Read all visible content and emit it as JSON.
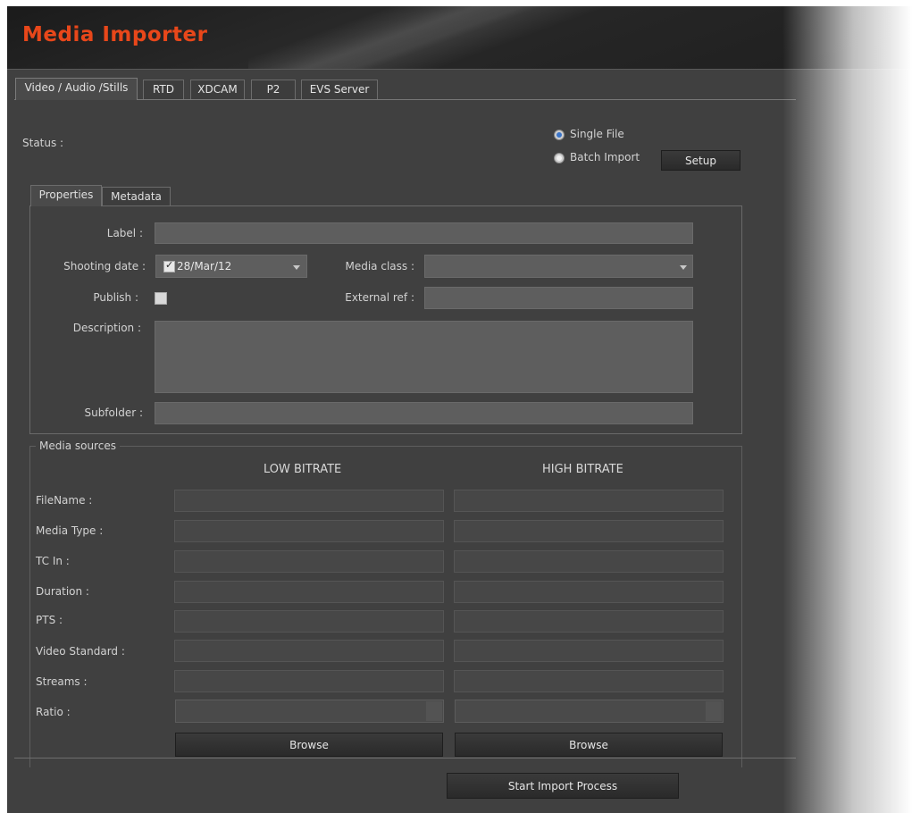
{
  "app": {
    "title": "Media Importer"
  },
  "main_tabs": [
    {
      "label": "Video / Audio /Stills",
      "active": true
    },
    {
      "label": "RTD",
      "active": false
    },
    {
      "label": "XDCAM",
      "active": false
    },
    {
      "label": "P2",
      "active": false
    },
    {
      "label": "EVS Server",
      "active": false
    }
  ],
  "status": {
    "label": "Status :"
  },
  "mode": {
    "single_file": "Single File",
    "batch_import": "Batch Import",
    "selected": "single_file",
    "setup_button": "Setup"
  },
  "sub_tabs": [
    {
      "label": "Properties",
      "active": true
    },
    {
      "label": "Metadata",
      "active": false
    }
  ],
  "properties": {
    "label_label": "Label :",
    "label_value": "",
    "shooting_date_label": "Shooting date :",
    "shooting_date_value": "28/Mar/12",
    "shooting_date_checked": true,
    "media_class_label": "Media class :",
    "media_class_value": "",
    "publish_label": "Publish :",
    "publish_checked": false,
    "external_ref_label": "External ref :",
    "external_ref_value": "",
    "description_label": "Description :",
    "description_value": "",
    "subfolder_label": "Subfolder :",
    "subfolder_value": ""
  },
  "media_sources": {
    "legend": "Media sources",
    "low_header": "LOW BITRATE",
    "high_header": "HIGH BITRATE",
    "rows": [
      {
        "label": "FileName :",
        "low": "",
        "high": ""
      },
      {
        "label": "Media Type :",
        "low": "",
        "high": ""
      },
      {
        "label": "TC In :",
        "low": "",
        "high": ""
      },
      {
        "label": "Duration :",
        "low": "",
        "high": ""
      },
      {
        "label": "PTS :",
        "low": "",
        "high": ""
      },
      {
        "label": "Video Standard :",
        "low": "",
        "high": ""
      },
      {
        "label": "Streams :",
        "low": "",
        "high": ""
      },
      {
        "label": "Ratio :",
        "low": "",
        "high": ""
      }
    ],
    "browse_low": "Browse",
    "browse_high": "Browse"
  },
  "start_button": "Start Import Process",
  "colors": {
    "accent": "#e8471a",
    "window_bg": "#404040",
    "radio_selected": "#3a74c8"
  }
}
